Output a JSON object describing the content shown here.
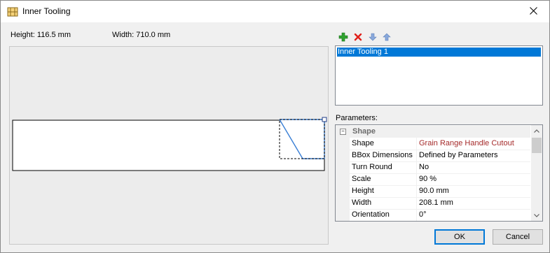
{
  "window": {
    "title": "Inner Tooling"
  },
  "dimensions": {
    "height": "Height: 116.5 mm",
    "width": "Width: 710.0 mm"
  },
  "toolbar": {
    "icons": [
      "add-icon",
      "delete-icon",
      "move-down-icon",
      "move-up-icon"
    ],
    "colors": {
      "add": "#2fa12f",
      "delete": "#e0201a",
      "arrows": "#8aa9dc"
    }
  },
  "tooling_list": {
    "items": [
      "Inner Tooling 1"
    ]
  },
  "parameters": {
    "label": "Parameters:",
    "category": "Shape",
    "rows": [
      {
        "name": "Shape",
        "value": "Grain Range Handle Cutout",
        "value_color": "#a52a2a"
      },
      {
        "name": "BBox Dimensions",
        "value": "Defined by Parameters"
      },
      {
        "name": "Turn Round",
        "value": "No"
      },
      {
        "name": "Scale",
        "value": "90 %"
      },
      {
        "name": "Height",
        "value": "90.0 mm"
      },
      {
        "name": "Width",
        "value": "208.1 mm"
      },
      {
        "name": "Orientation",
        "value": "0°"
      }
    ]
  },
  "buttons": {
    "ok": "OK",
    "cancel": "Cancel"
  },
  "colors": {
    "selection": "#0078d7",
    "shape_line": "#3a7fd5"
  }
}
